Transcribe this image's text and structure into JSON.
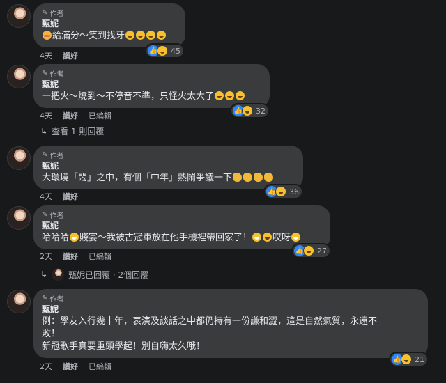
{
  "comments": [
    {
      "author_tag": "作者",
      "name": "甄妮",
      "text_before": "給滿分～笑到找牙",
      "time": "4天",
      "like": "讚好",
      "reaction_count": "45"
    },
    {
      "author_tag": "作者",
      "name": "甄妮",
      "text": "一把火～燒到～不停音不準，只怪火太大了",
      "time": "4天",
      "like": "讚好",
      "edited": "已編輯",
      "reaction_count": "32",
      "replies": "查看 1 則回覆"
    },
    {
      "author_tag": "作者",
      "name": "甄妮",
      "text": "大環境「悶」之中，有個「中年」熱鬧爭議一下",
      "time": "4天",
      "like": "讚好",
      "reaction_count": "36"
    },
    {
      "author_tag": "作者",
      "name": "甄妮",
      "text_a": "哈哈哈",
      "text_b": "賤宴～我被古冠軍放在他手機裡帶回家了！",
      "text_c": "哎呀",
      "time": "2天",
      "like": "讚好",
      "edited": "已編輯",
      "reaction_count": "27",
      "replies": "甄妮已回覆 · 2個回覆"
    },
    {
      "author_tag": "作者",
      "name": "甄妮",
      "line1": "例：學友入行幾十年，表演及談話之中都仍持有一份謙和澀，這是自然氣質，永遠不",
      "line2": "敗！",
      "line3": "新冠歌手真要重頭學起！別自嗨太久哦！",
      "time": "2天",
      "like": "讚好",
      "edited": "已編輯",
      "reaction_count": "21"
    }
  ],
  "colors": {
    "background": "#18191a",
    "bubble": "#3a3b3c",
    "like_blue": "#2d88ff"
  }
}
